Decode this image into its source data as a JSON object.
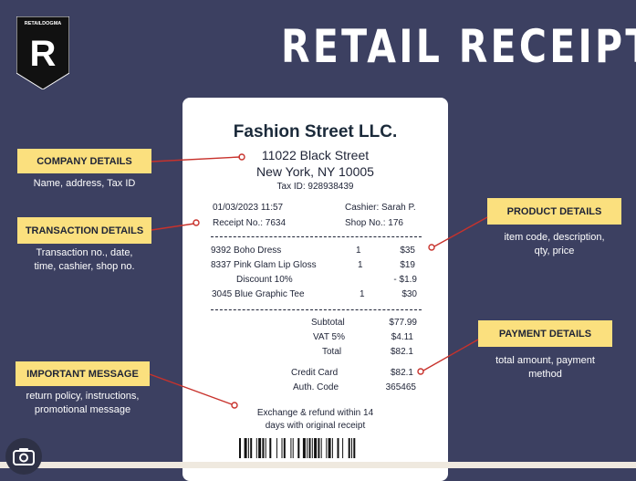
{
  "logo": {
    "brand": "RETAILDOGMA",
    "letter": "R"
  },
  "title": "RETAIL RECEIPT",
  "receipt": {
    "company_name": "Fashion Street LLC.",
    "address_line1": "11022 Black Street",
    "address_line2": "New York, NY 10005",
    "tax_id": "Tax ID: 928938439",
    "date_time": "01/03/2023  11:57",
    "cashier": "Cashier: Sarah P.",
    "receipt_no": "Receipt No.: 7634",
    "shop_no": "Shop No.: 176",
    "items": [
      {
        "desc": "9392 Boho Dress",
        "qty": "1",
        "price": "$35"
      },
      {
        "desc": "8337 Pink Glam Lip Gloss",
        "qty": "1",
        "price": "$19"
      },
      {
        "desc": "Discount 10%",
        "qty": "",
        "price": "- $1.9"
      },
      {
        "desc": "3045 Blue Graphic Tee",
        "qty": "1",
        "price": "$30"
      }
    ],
    "totals": [
      {
        "label": "Subtotal",
        "value": "$77.99"
      },
      {
        "label": "VAT 5%",
        "value": "$4.11"
      },
      {
        "label": "Total",
        "value": "$82.1"
      }
    ],
    "payment": [
      {
        "label": "Credit Card",
        "value": "$82.1"
      },
      {
        "label": "Auth. Code",
        "value": "365465"
      }
    ],
    "message_line1": "Exchange & refund within 14",
    "message_line2": "days with original receipt"
  },
  "callouts": {
    "company": {
      "title": "COMPANY DETAILS",
      "desc": "Name, address, Tax ID"
    },
    "transaction": {
      "title": "TRANSACTION DETAILS",
      "desc_line1": "Transaction no., date,",
      "desc_line2": "time, cashier, shop no."
    },
    "important": {
      "title": "IMPORTANT MESSAGE",
      "desc_line1": "return policy, instructions,",
      "desc_line2": "promotional message"
    },
    "product": {
      "title": "PRODUCT DETAILS",
      "desc_line1": "item code, description,",
      "desc_line2": "qty, price"
    },
    "payment": {
      "title": "PAYMENT DETAILS",
      "desc_line1": "total amount, payment",
      "desc_line2": "method"
    }
  },
  "colors": {
    "background": "#3c4061",
    "label": "#fbe07e",
    "connector": "#c8322c",
    "receipt": "#ffffff"
  }
}
